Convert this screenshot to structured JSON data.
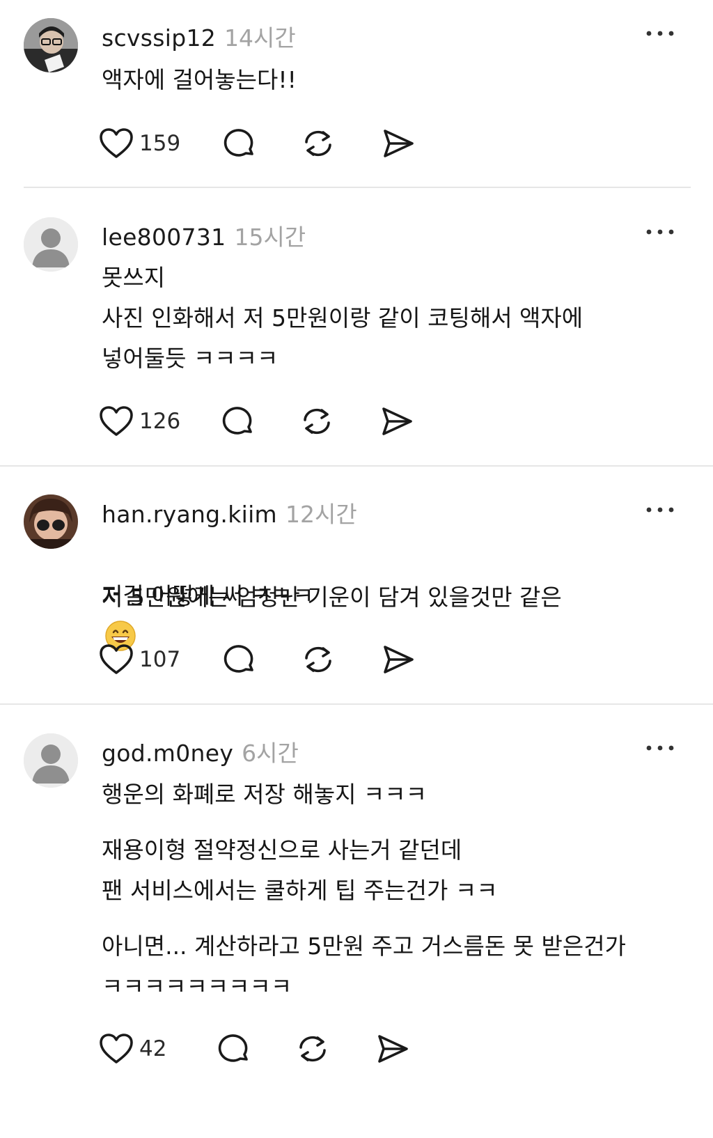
{
  "posts": [
    {
      "username": "scvssip12",
      "time": "14시간",
      "paragraphs": [
        "액자에 걸어놓는다!!"
      ],
      "likes": "159",
      "avatar": "photo"
    },
    {
      "username": "lee800731",
      "time": "15시간",
      "paragraphs": [
        "못쓰지\n 사진 인화해서 저 5만원이랑  같이 코팅해서 액자에\n넣어둘듯 ㅋㅋㅋㅋ"
      ],
      "likes": "126",
      "avatar": "default"
    },
    {
      "username": "han.ryang.kiim",
      "time": "12시간",
      "paragraphs": [
        "저 5만원에는 엄청난 기운이 담겨 있을것만 같은",
        "저걸 어떻게 써 ㅋㅋㅋ"
      ],
      "emoji": "grinning-face-with-smiling-eyes",
      "likes": "107",
      "avatar": "photo"
    },
    {
      "username": "god.m0ney",
      "time": "6시간",
      "paragraphs": [
        "행운의 화폐로 저장 해놓지 ㅋㅋㅋ",
        "재용이형 절약정신으로 사는거 같던데\n팬 서비스에서는 쿨하게 팁 주는건가 ㅋㅋ",
        "아니면... 계산하라고 5만원 주고 거스름돈 못 받은건가\nㅋㅋㅋㅋㅋㅋㅋㅋㅋ"
      ],
      "likes": "42",
      "avatar": "default"
    }
  ],
  "icons": {
    "like": "heart-icon",
    "reply": "comment-icon",
    "repost": "repost-icon",
    "share": "send-icon",
    "more": "more-dots-icon"
  },
  "colors": {
    "text": "#151515",
    "muted": "#a3a3a3",
    "divider": "#e6e6e6",
    "icon": "#1a1a1a"
  }
}
